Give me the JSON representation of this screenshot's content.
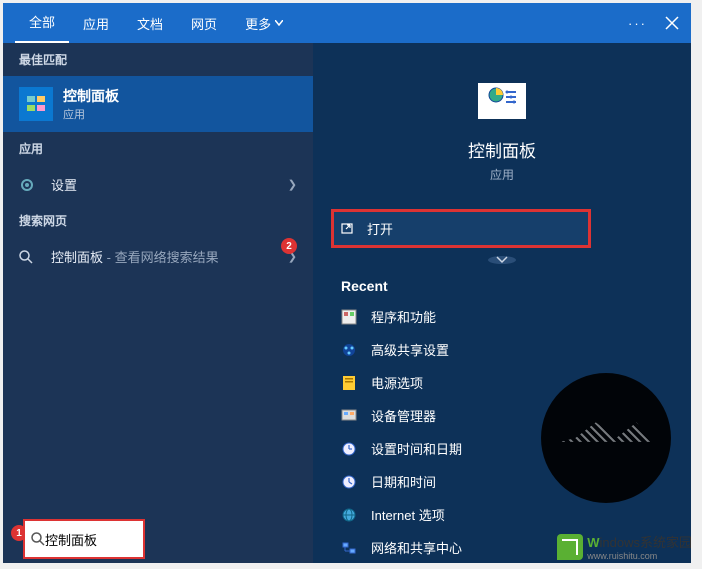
{
  "tabs": {
    "all": "全部",
    "apps": "应用",
    "docs": "文档",
    "web": "网页",
    "more": "更多"
  },
  "sections": {
    "best_match": "最佳匹配",
    "apps": "应用",
    "web": "搜索网页"
  },
  "best": {
    "title": "控制面板",
    "subtitle": "应用"
  },
  "app_row": {
    "label": "设置"
  },
  "web_row": {
    "prefix": "控制面板",
    "suffix": " - 查看网络搜索结果"
  },
  "preview": {
    "title": "控制面板",
    "subtitle": "应用",
    "open": "打开",
    "recent_header": "Recent",
    "recent": [
      "程序和功能",
      "高级共享设置",
      "电源选项",
      "设备管理器",
      "设置时间和日期",
      "日期和时间",
      "Internet 选项",
      "网络和共享中心"
    ]
  },
  "search": {
    "value": "控制面板"
  },
  "annotations": {
    "badge1": "1",
    "badge2": "2"
  },
  "watermark": {
    "brand_w": "W",
    "brand_rest": "indows系统家园",
    "url": "www.ruishitu.com"
  }
}
